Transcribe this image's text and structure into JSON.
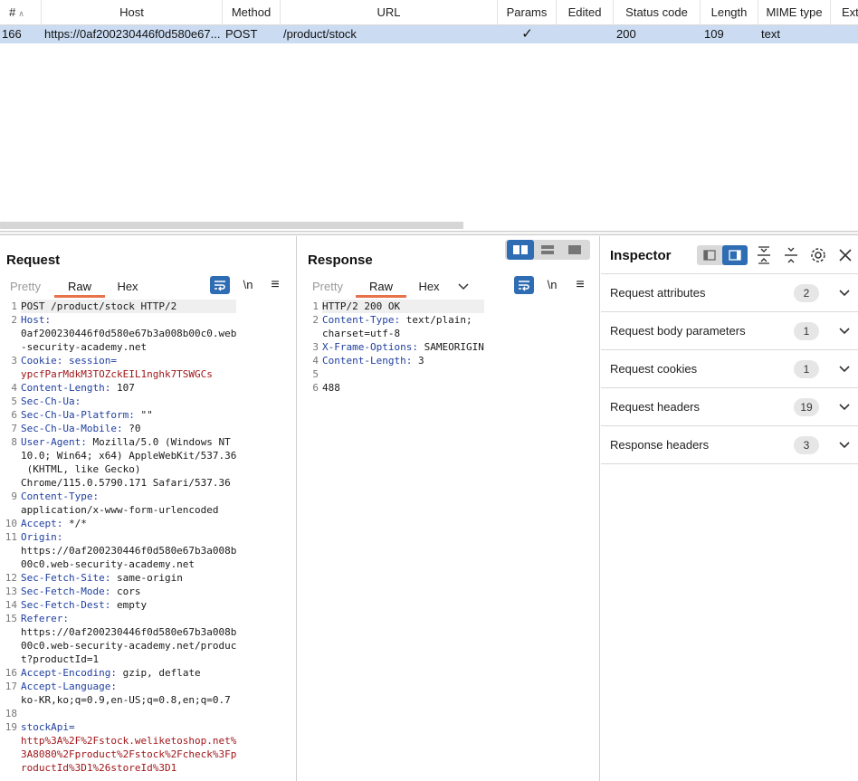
{
  "history": {
    "columns": [
      "#",
      "Host",
      "Method",
      "URL",
      "Params",
      "Edited",
      "Status code",
      "Length",
      "MIME type",
      "Ext"
    ],
    "rows": [
      {
        "num": "166",
        "host": "https://0af200230446f0d580e67...",
        "method": "POST",
        "url": "/product/stock",
        "params": "✓",
        "edited": "",
        "status": "200",
        "length": "109",
        "mime": "text",
        "ext": ""
      }
    ]
  },
  "request": {
    "title": "Request",
    "tabs": [
      "Pretty",
      "Raw",
      "Hex"
    ],
    "active_tab": "Raw",
    "newline_label": "\\n",
    "lines": [
      {
        "n": "1",
        "parts": [
          {
            "t": "POST /product/stock HTTP/2",
            "c": "v"
          }
        ]
      },
      {
        "n": "2",
        "parts": [
          {
            "t": "Host:",
            "c": "k"
          }
        ]
      },
      {
        "n": "",
        "parts": [
          {
            "t": "0af200230446f0d580e67b3a008b00c0.web",
            "c": "v"
          }
        ]
      },
      {
        "n": "",
        "parts": [
          {
            "t": "-security-academy.net",
            "c": "v"
          }
        ]
      },
      {
        "n": "3",
        "parts": [
          {
            "t": "Cookie: ",
            "c": "k"
          },
          {
            "t": "session=",
            "c": "k"
          }
        ]
      },
      {
        "n": "",
        "parts": [
          {
            "t": "ypcfParMdkM3TOZckEIL1nghk7TSWGCs",
            "c": "ck"
          }
        ]
      },
      {
        "n": "4",
        "parts": [
          {
            "t": "Content-Length:",
            "c": "k"
          },
          {
            "t": " 107",
            "c": "v"
          }
        ]
      },
      {
        "n": "5",
        "parts": [
          {
            "t": "Sec-Ch-Ua:",
            "c": "k"
          }
        ]
      },
      {
        "n": "6",
        "parts": [
          {
            "t": "Sec-Ch-Ua-Platform:",
            "c": "k"
          },
          {
            "t": " \"\"",
            "c": "v"
          }
        ]
      },
      {
        "n": "7",
        "parts": [
          {
            "t": "Sec-Ch-Ua-Mobile:",
            "c": "k"
          },
          {
            "t": " ?0",
            "c": "v"
          }
        ]
      },
      {
        "n": "8",
        "parts": [
          {
            "t": "User-Agent:",
            "c": "k"
          },
          {
            "t": " Mozilla/5.0 (Windows NT",
            "c": "v"
          }
        ]
      },
      {
        "n": "",
        "parts": [
          {
            "t": "10.0; Win64; x64) AppleWebKit/537.36",
            "c": "v"
          }
        ]
      },
      {
        "n": "",
        "parts": [
          {
            "t": " (KHTML, like Gecko)",
            "c": "v"
          }
        ]
      },
      {
        "n": "",
        "parts": [
          {
            "t": "Chrome/115.0.5790.171 Safari/537.36",
            "c": "v"
          }
        ]
      },
      {
        "n": "9",
        "parts": [
          {
            "t": "Content-Type:",
            "c": "k"
          }
        ]
      },
      {
        "n": "",
        "parts": [
          {
            "t": "application/x-www-form-urlencoded",
            "c": "v"
          }
        ]
      },
      {
        "n": "10",
        "parts": [
          {
            "t": "Accept:",
            "c": "k"
          },
          {
            "t": " */*",
            "c": "v"
          }
        ]
      },
      {
        "n": "11",
        "parts": [
          {
            "t": "Origin:",
            "c": "k"
          }
        ]
      },
      {
        "n": "",
        "parts": [
          {
            "t": "https://0af200230446f0d580e67b3a008b",
            "c": "v"
          }
        ]
      },
      {
        "n": "",
        "parts": [
          {
            "t": "00c0.web-security-academy.net",
            "c": "v"
          }
        ]
      },
      {
        "n": "12",
        "parts": [
          {
            "t": "Sec-Fetch-Site:",
            "c": "k"
          },
          {
            "t": " same-origin",
            "c": "v"
          }
        ]
      },
      {
        "n": "13",
        "parts": [
          {
            "t": "Sec-Fetch-Mode:",
            "c": "k"
          },
          {
            "t": " cors",
            "c": "v"
          }
        ]
      },
      {
        "n": "14",
        "parts": [
          {
            "t": "Sec-Fetch-Dest:",
            "c": "k"
          },
          {
            "t": " empty",
            "c": "v"
          }
        ]
      },
      {
        "n": "15",
        "parts": [
          {
            "t": "Referer:",
            "c": "k"
          }
        ]
      },
      {
        "n": "",
        "parts": [
          {
            "t": "https://0af200230446f0d580e67b3a008b",
            "c": "v"
          }
        ]
      },
      {
        "n": "",
        "parts": [
          {
            "t": "00c0.web-security-academy.net/produc",
            "c": "v"
          }
        ]
      },
      {
        "n": "",
        "parts": [
          {
            "t": "t?productId=1",
            "c": "v"
          }
        ]
      },
      {
        "n": "16",
        "parts": [
          {
            "t": "Accept-Encoding:",
            "c": "k"
          },
          {
            "t": " gzip, deflate",
            "c": "v"
          }
        ]
      },
      {
        "n": "17",
        "parts": [
          {
            "t": "Accept-Language:",
            "c": "k"
          }
        ]
      },
      {
        "n": "",
        "parts": [
          {
            "t": "ko-KR,ko;q=0.9,en-US;q=0.8,en;q=0.7",
            "c": "v"
          }
        ]
      },
      {
        "n": "18",
        "parts": [
          {
            "t": "",
            "c": "v"
          }
        ]
      },
      {
        "n": "19",
        "parts": [
          {
            "t": "stockApi=",
            "c": "k"
          }
        ]
      },
      {
        "n": "",
        "parts": [
          {
            "t": "http%3A%2F%2Fstock.weliketoshop.net%",
            "c": "rv"
          }
        ]
      },
      {
        "n": "",
        "parts": [
          {
            "t": "3A8080%2Fproduct%2Fstock%2Fcheck%3Fp",
            "c": "rv"
          }
        ]
      },
      {
        "n": "",
        "parts": [
          {
            "t": "roductId%3D1%26storeId%3D1",
            "c": "rv"
          }
        ]
      }
    ]
  },
  "response": {
    "title": "Response",
    "tabs": [
      "Pretty",
      "Raw",
      "Hex"
    ],
    "active_tab": "Raw",
    "newline_label": "\\n",
    "lines": [
      {
        "n": "1",
        "parts": [
          {
            "t": "HTTP/2 200 OK",
            "c": "v"
          }
        ]
      },
      {
        "n": "2",
        "parts": [
          {
            "t": "Content-Type:",
            "c": "k"
          },
          {
            "t": " text/plain;",
            "c": "v"
          }
        ]
      },
      {
        "n": "",
        "parts": [
          {
            "t": "charset=utf-8",
            "c": "v"
          }
        ]
      },
      {
        "n": "3",
        "parts": [
          {
            "t": "X-Frame-Options:",
            "c": "k"
          },
          {
            "t": " SAMEORIGIN",
            "c": "v"
          }
        ]
      },
      {
        "n": "4",
        "parts": [
          {
            "t": "Content-Length:",
            "c": "k"
          },
          {
            "t": " 3",
            "c": "v"
          }
        ]
      },
      {
        "n": "5",
        "parts": [
          {
            "t": "",
            "c": "v"
          }
        ]
      },
      {
        "n": "6",
        "parts": [
          {
            "t": "488",
            "c": "v"
          }
        ]
      }
    ]
  },
  "inspector": {
    "title": "Inspector",
    "sections": [
      {
        "label": "Request attributes",
        "count": "2"
      },
      {
        "label": "Request body parameters",
        "count": "1"
      },
      {
        "label": "Request cookies",
        "count": "1"
      },
      {
        "label": "Request headers",
        "count": "19"
      },
      {
        "label": "Response headers",
        "count": "3"
      }
    ]
  },
  "colors": {
    "accent": "#2e6db4",
    "tab_underline": "#e8724a",
    "header_key": "#1f3fa0",
    "value_red": "#a0161a",
    "selected_row": "#cbdcf2"
  }
}
